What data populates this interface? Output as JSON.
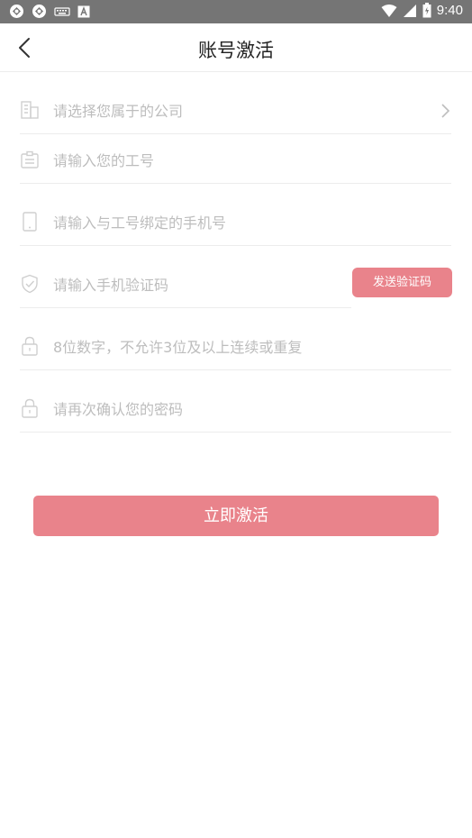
{
  "status_bar": {
    "time": "9:40",
    "icons": [
      "sync-icon",
      "sync-icon",
      "keyboard-icon",
      "font-icon",
      "wifi-icon",
      "signal-icon",
      "battery-icon"
    ]
  },
  "nav": {
    "title": "账号激活",
    "back_icon": "chevron-left-icon"
  },
  "form": {
    "company": {
      "placeholder": "请选择您属于的公司",
      "icon": "building-icon"
    },
    "employee_id": {
      "placeholder": "请输入您的工号",
      "icon": "badge-icon"
    },
    "phone": {
      "placeholder": "请输入与工号绑定的手机号",
      "icon": "phone-icon"
    },
    "sms_code": {
      "placeholder": "请输入手机验证码",
      "icon": "shield-check-icon"
    },
    "send_code_label": "发送验证码",
    "password": {
      "placeholder": "8位数字，不允许3位及以上连续或重复",
      "icon": "lock-icon"
    },
    "confirm_password": {
      "placeholder": "请再次确认您的密码",
      "icon": "lock-icon"
    }
  },
  "submit_label": "立即激活",
  "colors": {
    "accent": "#e9838b",
    "status_bar": "#757575",
    "placeholder": "#bdbdbd",
    "divider": "#ececec"
  }
}
